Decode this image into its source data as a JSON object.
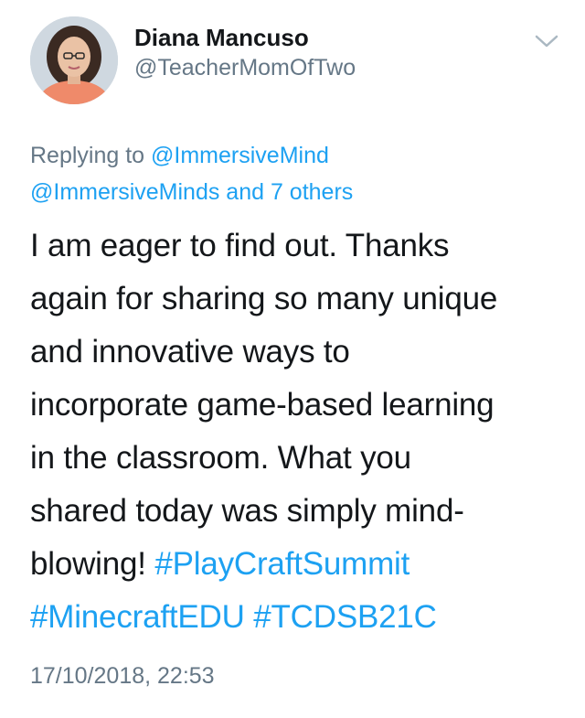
{
  "author": {
    "name": "Diana Mancuso",
    "handle": "@TeacherMomOfTwo"
  },
  "menu_icon": "chevron-down-icon",
  "reply": {
    "prefix": "Replying to ",
    "to": "@ImmersiveMind",
    "others_prefix": "@ImmersiveMinds and ",
    "others_link": "7 others"
  },
  "tweet": {
    "lines": [
      "I am eager to find out. Thanks",
      "again for sharing so many unique",
      "and innovative ways to",
      "incorporate game-based learning",
      "in the classroom. What you",
      "shared today was simply mind-"
    ],
    "line7_text": "blowing! ",
    "hashtags": [
      "#PlayCraftSummit",
      "#MinecraftEDU",
      "#TCDSB21C"
    ]
  },
  "timestamp": "17/10/2018, 22:53",
  "colors": {
    "link": "#1da1f2",
    "secondary": "#657786",
    "text": "#14171a"
  }
}
